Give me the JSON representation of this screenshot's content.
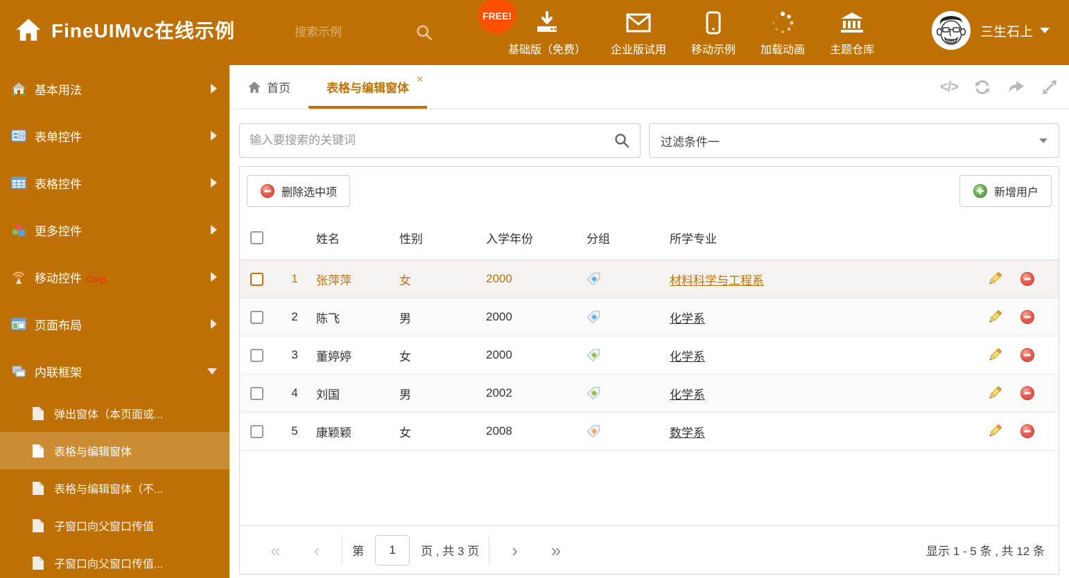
{
  "header": {
    "title": "FineUIMvc在线示例",
    "search_placeholder": "搜索示例",
    "free_badge": "FREE!",
    "nav": [
      {
        "label": "基础版（免费）",
        "icon": "download-icon"
      },
      {
        "label": "企业版试用",
        "icon": "envelope-icon"
      },
      {
        "label": "移动示例",
        "icon": "mobile-icon"
      },
      {
        "label": "加载动画",
        "icon": "spinner-icon"
      },
      {
        "label": "主题仓库",
        "icon": "bank-icon"
      }
    ],
    "user": {
      "name": "三生石上",
      "avatar": "cartoon-face"
    }
  },
  "sidebar": {
    "items": [
      {
        "label": "基本用法",
        "icon": "house-icon"
      },
      {
        "label": "表单控件",
        "icon": "form-icon"
      },
      {
        "label": "表格控件",
        "icon": "grid-icon"
      },
      {
        "label": "更多控件",
        "icon": "cubes-icon"
      },
      {
        "label": "移动控件",
        "icon": "antenna-icon",
        "badge": "Corp."
      },
      {
        "label": "页面布局",
        "icon": "layout-icon"
      },
      {
        "label": "内联框架",
        "icon": "frames-icon",
        "expanded": true
      }
    ],
    "children": [
      {
        "label": "弹出窗体（本页面或..."
      },
      {
        "label": "表格与编辑窗体",
        "selected": true
      },
      {
        "label": "表格与编辑窗体（不..."
      },
      {
        "label": "子窗口向父窗口传值"
      },
      {
        "label": "子窗口向父窗口传值..."
      }
    ]
  },
  "tabs": [
    {
      "label": "首页",
      "icon": "home-icon"
    },
    {
      "label": "表格与编辑窗体",
      "active": true,
      "close": "×"
    }
  ],
  "content": {
    "search_placeholder": "输入要搜索的关键词",
    "filter_value": "过滤条件一"
  },
  "toolbar": {
    "delete_label": "删除选中项",
    "add_label": "新增用户"
  },
  "table": {
    "columns": {
      "name": "姓名",
      "gender": "性别",
      "year": "入学年份",
      "group": "分组",
      "major": "所学专业"
    },
    "rows": [
      {
        "index": "1",
        "name": "张萍萍",
        "gender": "女",
        "year": "2000",
        "tag_color": "#5BB7E8",
        "major": "材料科学与工程系",
        "highlight": true
      },
      {
        "index": "2",
        "name": "陈飞",
        "gender": "男",
        "year": "2000",
        "tag_color": "#5BB7E8",
        "major": "化学系"
      },
      {
        "index": "3",
        "name": "董婷婷",
        "gender": "女",
        "year": "2000",
        "tag_color": "#8CC152",
        "major": "化学系"
      },
      {
        "index": "4",
        "name": "刘国",
        "gender": "男",
        "year": "2002",
        "tag_color": "#8CC152",
        "major": "化学系"
      },
      {
        "index": "5",
        "name": "康颖颖",
        "gender": "女",
        "year": "2008",
        "tag_color": "#F4A95B",
        "major": "数学系"
      }
    ]
  },
  "pagination": {
    "first": "«",
    "prev": "‹",
    "next": "›",
    "last": "»",
    "prefix": "第",
    "page": "1",
    "suffix": "页 , 共 3 页",
    "summary": "显示 1 - 5 条 , 共 12 条"
  },
  "colors": {
    "accent_orange": "#BE7102",
    "sidebar_selected": "#CC8C33",
    "active_tab": "#BF7200",
    "highlight_row_text": "#BF7203",
    "free_badge": "#FF4E00",
    "delete_red": "#E2574C",
    "add_green": "#6AAF5A",
    "tag_blue": "#5BB7E8",
    "tag_green": "#8CC152",
    "tag_orange": "#F4A95B"
  }
}
